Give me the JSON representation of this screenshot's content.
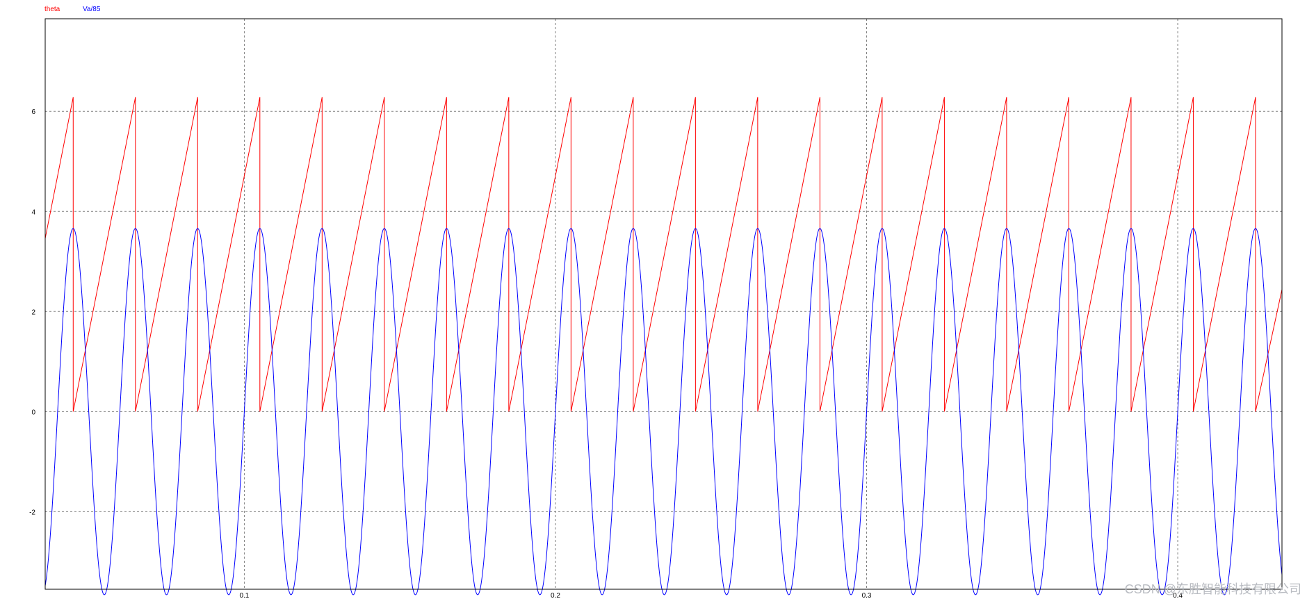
{
  "chart_data": {
    "type": "line",
    "title": "",
    "xlabel": "",
    "ylabel": "",
    "xlim": [
      0.036,
      0.4335
    ],
    "ylim": [
      -3.55,
      7.85
    ],
    "x_ticks": [
      0.1,
      0.2,
      0.3,
      0.4
    ],
    "y_ticks": [
      -2,
      0,
      2,
      4,
      6
    ],
    "x_tick_labels": [
      "0.1",
      "0.2",
      "0.3",
      "0.4"
    ],
    "y_tick_labels": [
      "-2",
      "0",
      "2",
      "4",
      "6"
    ],
    "grid": true,
    "legend_position": "top-left",
    "series": [
      {
        "name": "theta",
        "color": "#ff0000",
        "kind": "sawtooth",
        "min": 0,
        "max": 6.283,
        "period": 0.02,
        "reset_times": [
          0.045,
          0.065,
          0.085,
          0.105,
          0.125,
          0.145,
          0.165,
          0.185,
          0.205,
          0.225,
          0.245,
          0.265,
          0.285,
          0.305,
          0.325,
          0.345,
          0.365,
          0.385,
          0.405,
          0.425
        ],
        "start_value": 3.46,
        "end_value": 2.44
      },
      {
        "name": "Va/85",
        "color": "#0000ff",
        "kind": "cosine",
        "amplitude": 3.66,
        "period": 0.02,
        "peak_times": [
          0.045,
          0.065,
          0.085,
          0.105,
          0.125,
          0.145,
          0.165,
          0.185,
          0.205,
          0.225,
          0.245,
          0.265,
          0.285,
          0.305,
          0.325,
          0.345,
          0.365,
          0.385,
          0.405,
          0.425
        ]
      }
    ]
  },
  "legend": {
    "theta_label": "theta",
    "va_label": "Va/85"
  },
  "watermark": "CSDN @东胜智能科技有限公司",
  "colors": {
    "axis": "#000000",
    "grid": "#808080",
    "background": "#ffffff",
    "watermark": "#b9bcc2"
  }
}
